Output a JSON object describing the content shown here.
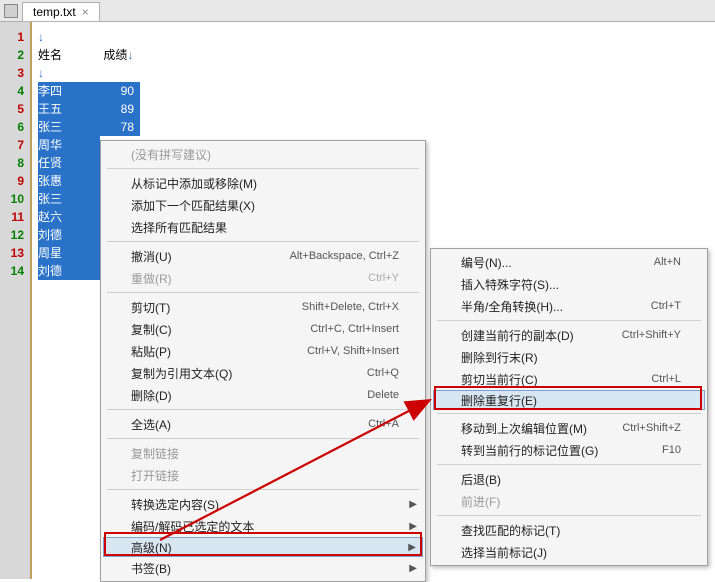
{
  "tab": {
    "filename": "temp.txt",
    "close": "×"
  },
  "header": {
    "name": "姓名",
    "score": "成绩"
  },
  "rows": [
    {
      "name": "李四",
      "score": "90"
    },
    {
      "name": "王五",
      "score": "89"
    },
    {
      "name": "张三",
      "score": "78"
    },
    {
      "name": "周华",
      "score": ""
    },
    {
      "name": "任贤",
      "score": ""
    },
    {
      "name": "张惠",
      "score": ""
    },
    {
      "name": "张三",
      "score": ""
    },
    {
      "name": "赵六",
      "score": ""
    },
    {
      "name": "刘德",
      "score": ""
    },
    {
      "name": "周星",
      "score": ""
    },
    {
      "name": "刘德",
      "score": ""
    }
  ],
  "menu1": {
    "no_suggest": "(没有拼写建议)",
    "add_remove_mark": "从标记中添加或移除(M)",
    "add_next_match": "添加下一个匹配结果(X)",
    "select_all_match": "选择所有匹配结果",
    "undo": "撤消(U)",
    "undo_hk": "Alt+Backspace, Ctrl+Z",
    "redo": "重做(R)",
    "redo_hk": "Ctrl+Y",
    "cut": "剪切(T)",
    "cut_hk": "Shift+Delete, Ctrl+X",
    "copy": "复制(C)",
    "copy_hk": "Ctrl+C, Ctrl+Insert",
    "paste": "粘贴(P)",
    "paste_hk": "Ctrl+V, Shift+Insert",
    "copy_quote": "复制为引用文本(Q)",
    "copy_quote_hk": "Ctrl+Q",
    "delete": "删除(D)",
    "delete_hk": "Delete",
    "select_all": "全选(A)",
    "select_all_hk": "Ctrl+A",
    "copy_link": "复制链接",
    "open_link": "打开链接",
    "convert_sel": "转换选定内容(S)",
    "encode_sel": "编码/解码已选定的文本",
    "advanced": "高级(N)",
    "bookmarks": "书签(B)"
  },
  "menu2": {
    "numbering": "编号(N)...",
    "numbering_hk": "Alt+N",
    "insert_special": "插入特殊字符(S)...",
    "half_full": "半角/全角转换(H)...",
    "half_full_hk": "Ctrl+T",
    "dup_line": "创建当前行的副本(D)",
    "dup_line_hk": "Ctrl+Shift+Y",
    "del_eol": "删除到行末(R)",
    "cut_line": "剪切当前行(C)",
    "cut_line_hk": "Ctrl+L",
    "del_dup": "删除重复行(E)",
    "move_last_edit": "移动到上次编辑位置(M)",
    "move_last_edit_hk": "Ctrl+Shift+Z",
    "goto_mark": "转到当前行的标记位置(G)",
    "goto_mark_hk": "F10",
    "back": "后退(B)",
    "forward": "前进(F)",
    "find_match_mark": "查找匹配的标记(T)",
    "select_cur_mark": "选择当前标记(J)"
  },
  "arrow_glyph": "↓",
  "submenu_glyph": "▶"
}
